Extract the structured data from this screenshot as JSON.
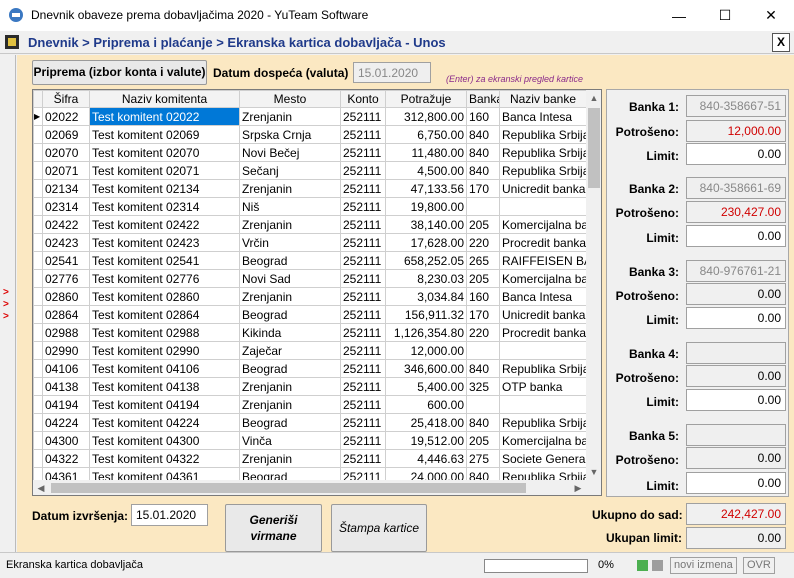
{
  "window": {
    "title": "Dnevnik obaveze prema dobavljačima 2020 - YuTeam Software",
    "minimize_glyph": "—",
    "maximize_glyph": "☐",
    "close_glyph": "✕"
  },
  "header": {
    "breadcrumb": "Dnevnik > Priprema i plaćanje > Ekranska kartica dobavljača - Unos",
    "close_label": "X"
  },
  "side": {
    "arrows": [
      ">",
      ">",
      ">"
    ]
  },
  "toolbar": {
    "prep_button": "Priprema (izbor konta i valute)",
    "due_label": "Datum dospeća (valuta)",
    "due_value": "15.01.2020",
    "hint": "(Enter) za ekranski pregled kartice"
  },
  "grid": {
    "columns": [
      "Šifra",
      "Naziv komitenta",
      "Mesto",
      "Konto",
      "Potražuje",
      "Banka",
      "Naziv banke"
    ],
    "rows": [
      [
        "02022",
        "Test komitent 02022",
        "Zrenjanin",
        "252111",
        "312,800.00",
        "160",
        "Banca Intesa"
      ],
      [
        "02069",
        "Test komitent 02069",
        "Srpska Crnja",
        "252111",
        "6,750.00",
        "840",
        "Republika Srbija"
      ],
      [
        "02070",
        "Test komitent 02070",
        "Novi Bečej",
        "252111",
        "11,480.00",
        "840",
        "Republika Srbija"
      ],
      [
        "02071",
        "Test komitent 02071",
        "Sečanj",
        "252111",
        "4,500.00",
        "840",
        "Republika Srbija"
      ],
      [
        "02134",
        "Test komitent 02134",
        "Zrenjanin",
        "252111",
        "47,133.56",
        "170",
        "Unicredit banka"
      ],
      [
        "02314",
        "Test komitent 02314",
        "Niš",
        "252111",
        "19,800.00",
        "",
        ""
      ],
      [
        "02422",
        "Test komitent 02422",
        "Zrenjanin",
        "252111",
        "38,140.00",
        "205",
        "Komercijalna banka"
      ],
      [
        "02423",
        "Test komitent 02423",
        "Vrčin",
        "252111",
        "17,628.00",
        "220",
        "Procredit banka"
      ],
      [
        "02541",
        "Test komitent 02541",
        "Beograd",
        "252111",
        "658,252.05",
        "265",
        "RAIFFEISEN BANK"
      ],
      [
        "02776",
        "Test komitent 02776",
        "Novi Sad",
        "252111",
        "8,230.03",
        "205",
        "Komercijalna banka"
      ],
      [
        "02860",
        "Test komitent 02860",
        "Zrenjanin",
        "252111",
        "3,034.84",
        "160",
        "Banca Intesa"
      ],
      [
        "02864",
        "Test komitent 02864",
        "Beograd",
        "252111",
        "156,911.32",
        "170",
        "Unicredit banka"
      ],
      [
        "02988",
        "Test komitent 02988",
        "Kikinda",
        "252111",
        "1,126,354.80",
        "220",
        "Procredit banka"
      ],
      [
        "02990",
        "Test komitent 02990",
        "Zaječar",
        "252111",
        "12,000.00",
        "",
        ""
      ],
      [
        "04106",
        "Test komitent 04106",
        "Beograd",
        "252111",
        "346,600.00",
        "840",
        "Republika Srbija"
      ],
      [
        "04138",
        "Test komitent 04138",
        "Zrenjanin",
        "252111",
        "5,400.00",
        "325",
        "OTP banka"
      ],
      [
        "04194",
        "Test komitent 04194",
        "Zrenjanin",
        "252111",
        "600.00",
        "",
        ""
      ],
      [
        "04224",
        "Test komitent 04224",
        "Beograd",
        "252111",
        "25,418.00",
        "840",
        "Republika Srbija"
      ],
      [
        "04300",
        "Test komitent 04300",
        "Vinča",
        "252111",
        "19,512.00",
        "205",
        "Komercijalna banka"
      ],
      [
        "04322",
        "Test komitent 04322",
        "Zrenjanin",
        "252111",
        "4,446.63",
        "275",
        "Societe Generale"
      ],
      [
        "04361",
        "Test komitent 04361",
        "Beograd",
        "252111",
        "24,000.00",
        "840",
        "Republika Srbija"
      ]
    ],
    "scroll_up": "▲",
    "scroll_down": "▼",
    "scroll_left": "◀",
    "scroll_right": "▶"
  },
  "banks": [
    {
      "label": "Banka 1:",
      "account": "840-358667-51",
      "spent_label": "Potrošeno:",
      "spent": "12,000.00",
      "limit_label": "Limit:",
      "limit": "0.00"
    },
    {
      "label": "Banka 2:",
      "account": "840-358661-69",
      "spent_label": "Potrošeno:",
      "spent": "230,427.00",
      "limit_label": "Limit:",
      "limit": "0.00"
    },
    {
      "label": "Banka 3:",
      "account": "840-976761-21",
      "spent_label": "Potrošeno:",
      "spent": "0.00",
      "limit_label": "Limit:",
      "limit": "0.00"
    },
    {
      "label": "Banka 4:",
      "account": "",
      "spent_label": "Potrošeno:",
      "spent": "0.00",
      "limit_label": "Limit:",
      "limit": "0.00"
    },
    {
      "label": "Banka 5:",
      "account": "",
      "spent_label": "Potrošeno:",
      "spent": "0.00",
      "limit_label": "Limit:",
      "limit": "0.00"
    }
  ],
  "footer": {
    "exec_label": "Datum izvršenja:",
    "exec_value": "15.01.2020",
    "generate_line1": "Generiši",
    "generate_line2": "virmane",
    "print_label": "Štampa kartice",
    "total_label": "Ukupno do sad:",
    "total_value": "242,427.00",
    "limit_label": "Ukupan limit:",
    "limit_value": "0.00"
  },
  "status": {
    "text": "Ekranska kartica dobavljača",
    "progress": 0,
    "percent": "0%",
    "changes": "novi izmena",
    "mode": "OVR",
    "colors": {
      "led1": "#4caf50",
      "led2": "#9e9e9e",
      "progress": "#86b3a4"
    }
  }
}
